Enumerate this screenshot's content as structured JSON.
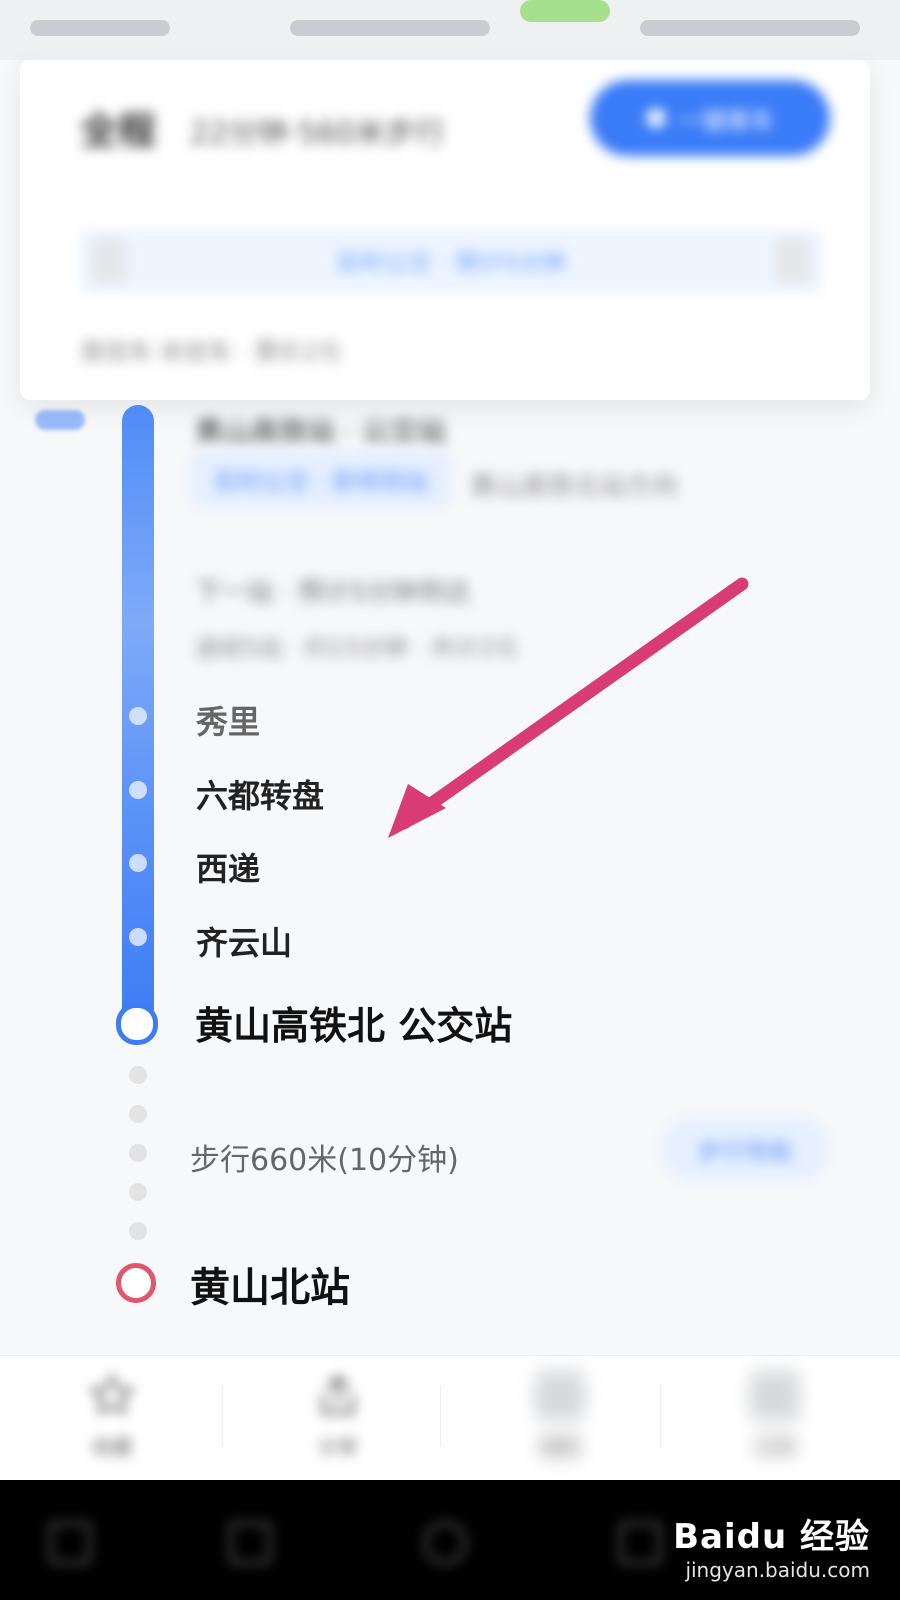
{
  "topCard": {
    "title": "全程",
    "subtitle": "22分钟·560米步行",
    "ctaLabel": "一键乘车",
    "ticketLabel": "实时公交 · 预计5分钟",
    "meta": "首班车·末班车 · 票价2元"
  },
  "busSegment": {
    "boardStop": "黄山高铁站 · 公交站",
    "busChip": "实时公交 · 即将到站",
    "direction": "黄山高铁北站方向",
    "nextInfo": "下一站 · 预计5分钟到达",
    "detail": "途经5站 · 约15分钟 · 共计2元"
  },
  "stops": [
    "秀里",
    "六都转盘",
    "西递",
    "齐云山"
  ],
  "arrive": "黄山高铁北 公交站",
  "walk": {
    "text": "步行660米(10分钟)",
    "button": "步行导航"
  },
  "destination": "黄山北站",
  "toolbar": {
    "items": [
      {
        "label": "收藏"
      },
      {
        "label": "分享"
      },
      {
        "label": "截图"
      },
      {
        "label": "反馈"
      }
    ]
  },
  "watermark": {
    "brand": "Baidu 经验",
    "url": "jingyan.baidu.com"
  }
}
